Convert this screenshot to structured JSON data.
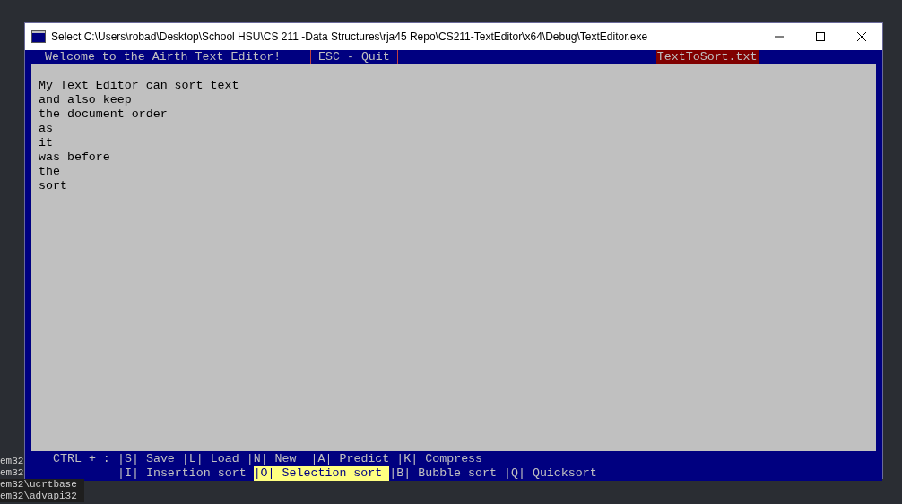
{
  "background": {
    "lines": [
      "em32",
      "em32",
      "em32\\ucrtbase",
      "em32\\advapi32"
    ]
  },
  "window": {
    "title": "Select C:\\Users\\robad\\Desktop\\School HSU\\CS 211 -Data Structures\\rja45 Repo\\CS211-TextEditor\\x64\\Debug\\TextEditor.exe"
  },
  "header": {
    "welcome": "Welcome to the Airth Text Editor!",
    "quit": "ESC - Quit",
    "filename": "TextToSort.txt"
  },
  "document": {
    "lines": [
      "My Text Editor can sort text",
      "and also keep",
      "the document order",
      "as",
      "it",
      "was before",
      "the",
      "sort"
    ]
  },
  "footer": {
    "prefix": "CTRL + :",
    "rows": [
      {
        "items": [
          {
            "key": "|S|",
            "label": "Save",
            "selected": false
          },
          {
            "key": "|L|",
            "label": "Load",
            "selected": false
          },
          {
            "key": "|N|",
            "label": "New ",
            "selected": false
          },
          {
            "key": "|A|",
            "label": "Predict",
            "selected": false
          },
          {
            "key": "|K|",
            "label": "Compress",
            "selected": false
          }
        ]
      },
      {
        "items": [
          {
            "key": "|I|",
            "label": "Insertion sort",
            "selected": false
          },
          {
            "key": "|O|",
            "label": "Selection sort",
            "selected": true
          },
          {
            "key": "|B|",
            "label": "Bubble sort",
            "selected": false
          },
          {
            "key": "|Q|",
            "label": "Quicksort",
            "selected": false
          }
        ]
      }
    ]
  }
}
